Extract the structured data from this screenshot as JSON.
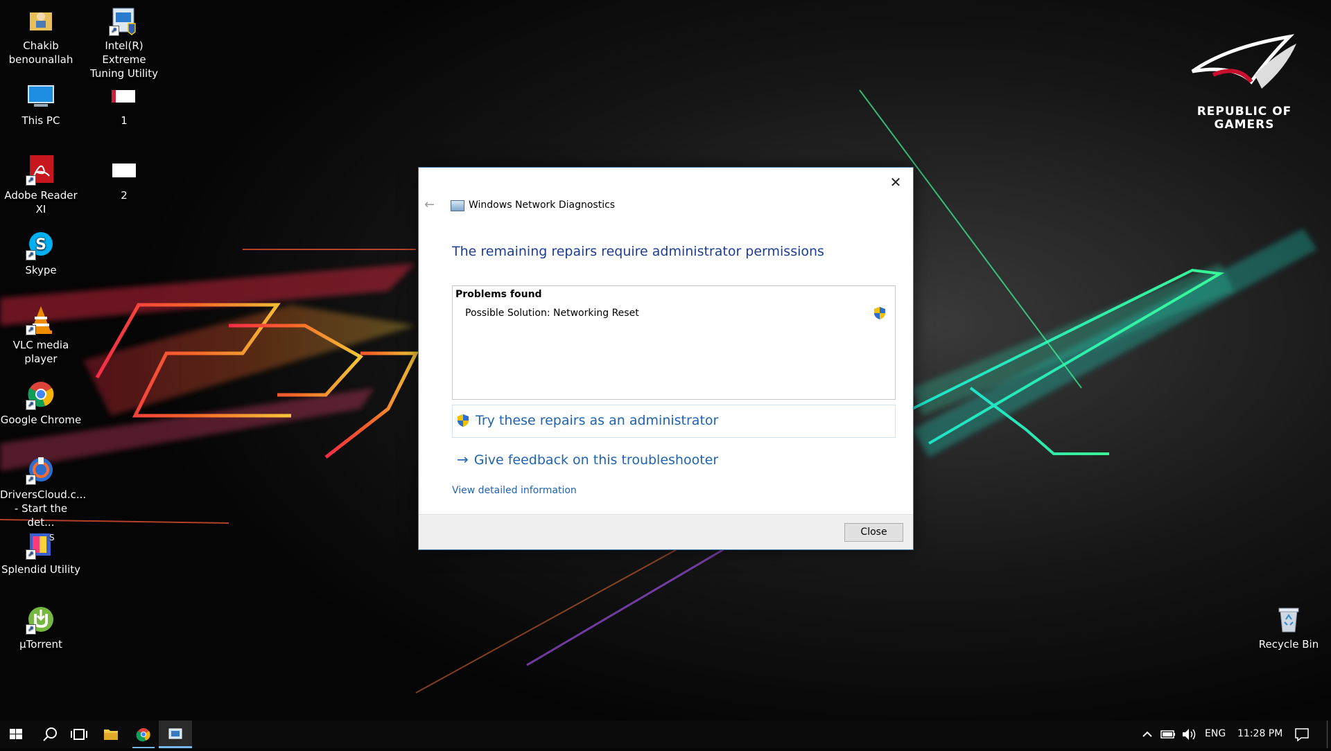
{
  "desktop_icons": [
    {
      "label": "Chakib\nbenounallah",
      "icon": "user-folder-icon"
    },
    {
      "label": "Intel(R) Extreme\nTuning Utility",
      "icon": "intel-xtu-icon"
    },
    {
      "label": "This PC",
      "icon": "this-pc-icon"
    },
    {
      "label": "1",
      "icon": "file-icon"
    },
    {
      "label": "Adobe Reader XI",
      "icon": "adobe-reader-icon"
    },
    {
      "label": "2",
      "icon": "file-icon"
    },
    {
      "label": "Skype",
      "icon": "skype-icon"
    },
    {
      "label": "VLC media player",
      "icon": "vlc-icon"
    },
    {
      "label": "Google Chrome",
      "icon": "chrome-icon"
    },
    {
      "label": "DriversCloud.c...\n- Start the det...",
      "icon": "driverscloud-icon"
    },
    {
      "label": "Splendid Utility",
      "icon": "splendid-icon"
    },
    {
      "label": "µTorrent",
      "icon": "utorrent-icon"
    },
    {
      "label": "Recycle Bin",
      "icon": "recycle-bin-icon"
    }
  ],
  "wallpaper": {
    "brand_line1": "REPUBLIC OF",
    "brand_line2": "GAMERS"
  },
  "dialog": {
    "title": "Windows Network Diagnostics",
    "heading": "The remaining repairs require administrator permissions",
    "problems_title": "Problems found",
    "problem_item": "Possible Solution: Networking Reset",
    "try_admin": "Try these repairs as an administrator",
    "feedback": "Give feedback on this troubleshooter",
    "details_link": "View detailed information",
    "close_button": "Close"
  },
  "taskbar": {
    "language": "ENG",
    "time": "11:28 PM"
  },
  "colors": {
    "link_blue": "#1f63b4",
    "heading_blue": "#1b3d94",
    "taskbar": "#0b0b0b"
  }
}
